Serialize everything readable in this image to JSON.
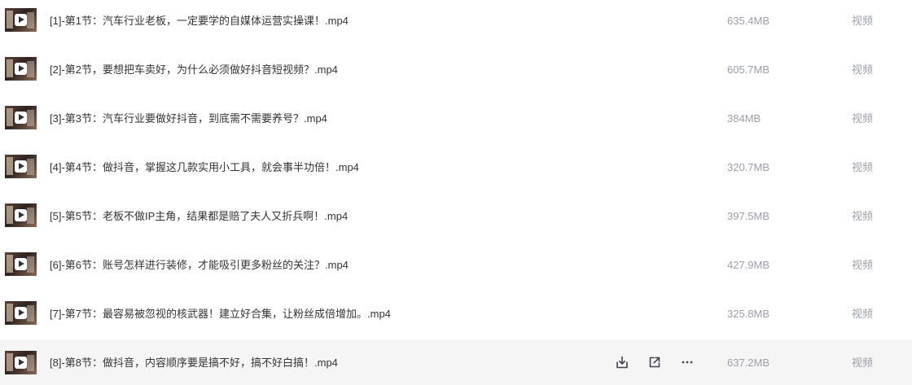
{
  "files": [
    {
      "name": "[1]-第1节：汽车行业老板，一定要学的自媒体运营实操课！.mp4",
      "size": "635.4MB",
      "type": "视频"
    },
    {
      "name": "[2]-第2节，要想把车卖好，为什么必须做好抖音短视频？.mp4",
      "size": "605.7MB",
      "type": "视频"
    },
    {
      "name": "[3]-第3节：汽车行业要做好抖音，到底需不需要养号？.mp4",
      "size": "384MB",
      "type": "视频"
    },
    {
      "name": "[4]-第4节：做抖音，掌握这几款实用小工具，就会事半功倍！.mp4",
      "size": "320.7MB",
      "type": "视频"
    },
    {
      "name": "[5]-第5节：老板不做IP主角，结果都是赔了夫人又折兵啊！.mp4",
      "size": "397.5MB",
      "type": "视频"
    },
    {
      "name": "[6]-第6节：账号怎样进行装修，才能吸引更多粉丝的关注？.mp4",
      "size": "427.9MB",
      "type": "视频"
    },
    {
      "name": "[7]-第7节：最容易被忽视的核武器！建立好合集，让粉丝成倍增加。.mp4",
      "size": "325.8MB",
      "type": "视频"
    },
    {
      "name": "[8]-第8节：做抖音，内容顺序要是搞不好，搞不好白搞！.mp4",
      "size": "637.2MB",
      "type": "视频"
    }
  ],
  "icons": {
    "row_thumbnail": "video-thumbnail-icon",
    "play": "play-icon",
    "download": "download-icon",
    "share": "share-icon",
    "more": "more-icon"
  },
  "colors": {
    "hover_row_background": "#f5f5f6",
    "primary_text": "#333333",
    "secondary_text": "#9b9ea8"
  },
  "hovered_row_index": 7
}
